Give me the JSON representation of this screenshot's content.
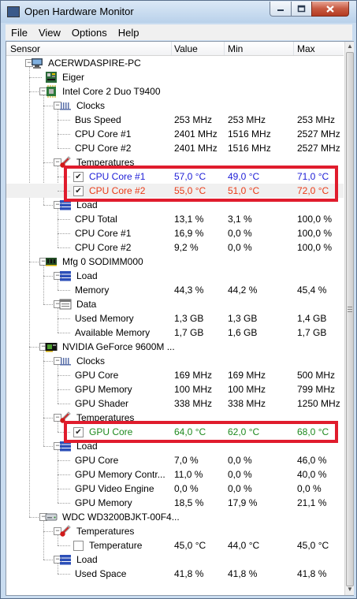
{
  "window": {
    "title": "Open Hardware Monitor"
  },
  "menu": [
    "File",
    "View",
    "Options",
    "Help"
  ],
  "columns": {
    "sensor": "Sensor",
    "value": "Value",
    "min": "Min",
    "max": "Max"
  },
  "rows": [
    {
      "label": "ACERWDASPIRE-PC",
      "icon": "computer-icon",
      "depth": 0,
      "expander": "-",
      "value": "",
      "min": "",
      "max": ""
    },
    {
      "label": "Eiger",
      "icon": "motherboard-icon",
      "depth": 1,
      "expander": "",
      "value": "",
      "min": "",
      "max": ""
    },
    {
      "label": "Intel Core 2 Duo T9400",
      "icon": "cpu-icon",
      "depth": 1,
      "expander": "-",
      "value": "",
      "min": "",
      "max": ""
    },
    {
      "label": "Clocks",
      "icon": "clock-icon",
      "depth": 2,
      "expander": "-",
      "value": "",
      "min": "",
      "max": ""
    },
    {
      "label": "Bus Speed",
      "depth": 3,
      "value": "253 MHz",
      "min": "253 MHz",
      "max": "253 MHz"
    },
    {
      "label": "CPU Core #1",
      "depth": 3,
      "value": "2401 MHz",
      "min": "1516 MHz",
      "max": "2527 MHz"
    },
    {
      "label": "CPU Core #2",
      "depth": 3,
      "value": "2401 MHz",
      "min": "1516 MHz",
      "max": "2527 MHz"
    },
    {
      "label": "Temperatures",
      "icon": "thermometer-icon",
      "depth": 2,
      "expander": "-",
      "value": "",
      "min": "",
      "max": ""
    },
    {
      "label": "CPU Core #1",
      "depth": 3,
      "checkbox": true,
      "checked": true,
      "color": "#1d1dd6",
      "value": "57,0 °C",
      "min": "49,0 °C",
      "max": "71,0 °C"
    },
    {
      "label": "CPU Core #2",
      "depth": 3,
      "checkbox": true,
      "checked": true,
      "color": "#ea3b18",
      "value": "55,0 °C",
      "min": "51,0 °C",
      "max": "72,0 °C"
    },
    {
      "label": "Load",
      "icon": "load-icon",
      "depth": 2,
      "expander": "-",
      "value": "",
      "min": "",
      "max": ""
    },
    {
      "label": "CPU Total",
      "depth": 3,
      "value": "13,1 %",
      "min": "3,1 %",
      "max": "100,0 %"
    },
    {
      "label": "CPU Core #1",
      "depth": 3,
      "value": "16,9 %",
      "min": "0,0 %",
      "max": "100,0 %"
    },
    {
      "label": "CPU Core #2",
      "depth": 3,
      "value": "9,2 %",
      "min": "0,0 %",
      "max": "100,0 %"
    },
    {
      "label": "Mfg 0 SODIMM000",
      "icon": "ram-icon",
      "depth": 1,
      "expander": "-",
      "value": "",
      "min": "",
      "max": ""
    },
    {
      "label": "Load",
      "icon": "load-icon",
      "depth": 2,
      "expander": "-",
      "value": "",
      "min": "",
      "max": ""
    },
    {
      "label": "Memory",
      "depth": 3,
      "value": "44,3 %",
      "min": "44,2 %",
      "max": "45,4 %"
    },
    {
      "label": "Data",
      "icon": "data-icon",
      "depth": 2,
      "expander": "-",
      "value": "",
      "min": "",
      "max": ""
    },
    {
      "label": "Used Memory",
      "depth": 3,
      "value": "1,3 GB",
      "min": "1,3 GB",
      "max": "1,4 GB"
    },
    {
      "label": "Available Memory",
      "depth": 3,
      "value": "1,7 GB",
      "min": "1,6 GB",
      "max": "1,7 GB"
    },
    {
      "label": "NVIDIA GeForce 9600M ...",
      "icon": "gpu-icon",
      "depth": 1,
      "expander": "-",
      "value": "",
      "min": "",
      "max": ""
    },
    {
      "label": "Clocks",
      "icon": "clock-icon",
      "depth": 2,
      "expander": "-",
      "value": "",
      "min": "",
      "max": ""
    },
    {
      "label": "GPU Core",
      "depth": 3,
      "value": "169 MHz",
      "min": "169 MHz",
      "max": "500 MHz"
    },
    {
      "label": "GPU Memory",
      "depth": 3,
      "value": "100 MHz",
      "min": "100 MHz",
      "max": "799 MHz"
    },
    {
      "label": "GPU Shader",
      "depth": 3,
      "value": "338 MHz",
      "min": "338 MHz",
      "max": "1250 MHz"
    },
    {
      "label": "Temperatures",
      "icon": "thermometer-icon",
      "depth": 2,
      "expander": "-",
      "value": "",
      "min": "",
      "max": ""
    },
    {
      "label": "GPU Core",
      "depth": 3,
      "checkbox": true,
      "checked": true,
      "color": "#1f8a1f",
      "value": "64,0 °C",
      "min": "62,0 °C",
      "max": "68,0 °C"
    },
    {
      "label": "Load",
      "icon": "load-icon",
      "depth": 2,
      "expander": "-",
      "value": "",
      "min": "",
      "max": ""
    },
    {
      "label": "GPU Core",
      "depth": 3,
      "value": "7,0 %",
      "min": "0,0 %",
      "max": "46,0 %"
    },
    {
      "label": "GPU Memory Contr...",
      "depth": 3,
      "value": "11,0 %",
      "min": "0,0 %",
      "max": "40,0 %"
    },
    {
      "label": "GPU Video Engine",
      "depth": 3,
      "value": "0,0 %",
      "min": "0,0 %",
      "max": "0,0 %"
    },
    {
      "label": "GPU Memory",
      "depth": 3,
      "value": "18,5 %",
      "min": "17,9 %",
      "max": "21,1 %"
    },
    {
      "label": "WDC WD3200BJKT-00F4...",
      "icon": "hdd-icon",
      "depth": 1,
      "expander": "-",
      "value": "",
      "min": "",
      "max": ""
    },
    {
      "label": "Temperatures",
      "icon": "thermometer-icon",
      "depth": 2,
      "expander": "-",
      "value": "",
      "min": "",
      "max": ""
    },
    {
      "label": "Temperature",
      "depth": 3,
      "checkbox": true,
      "checked": false,
      "value": "45,0 °C",
      "min": "44,0 °C",
      "max": "45,0 °C"
    },
    {
      "label": "Load",
      "icon": "load-icon",
      "depth": 2,
      "expander": "-",
      "value": "",
      "min": "",
      "max": ""
    },
    {
      "label": "Used Space",
      "depth": 3,
      "value": "41,8 %",
      "min": "41,8 %",
      "max": "41,8 %"
    }
  ],
  "selected_row": 9,
  "highlight_color": "#e01c2d"
}
